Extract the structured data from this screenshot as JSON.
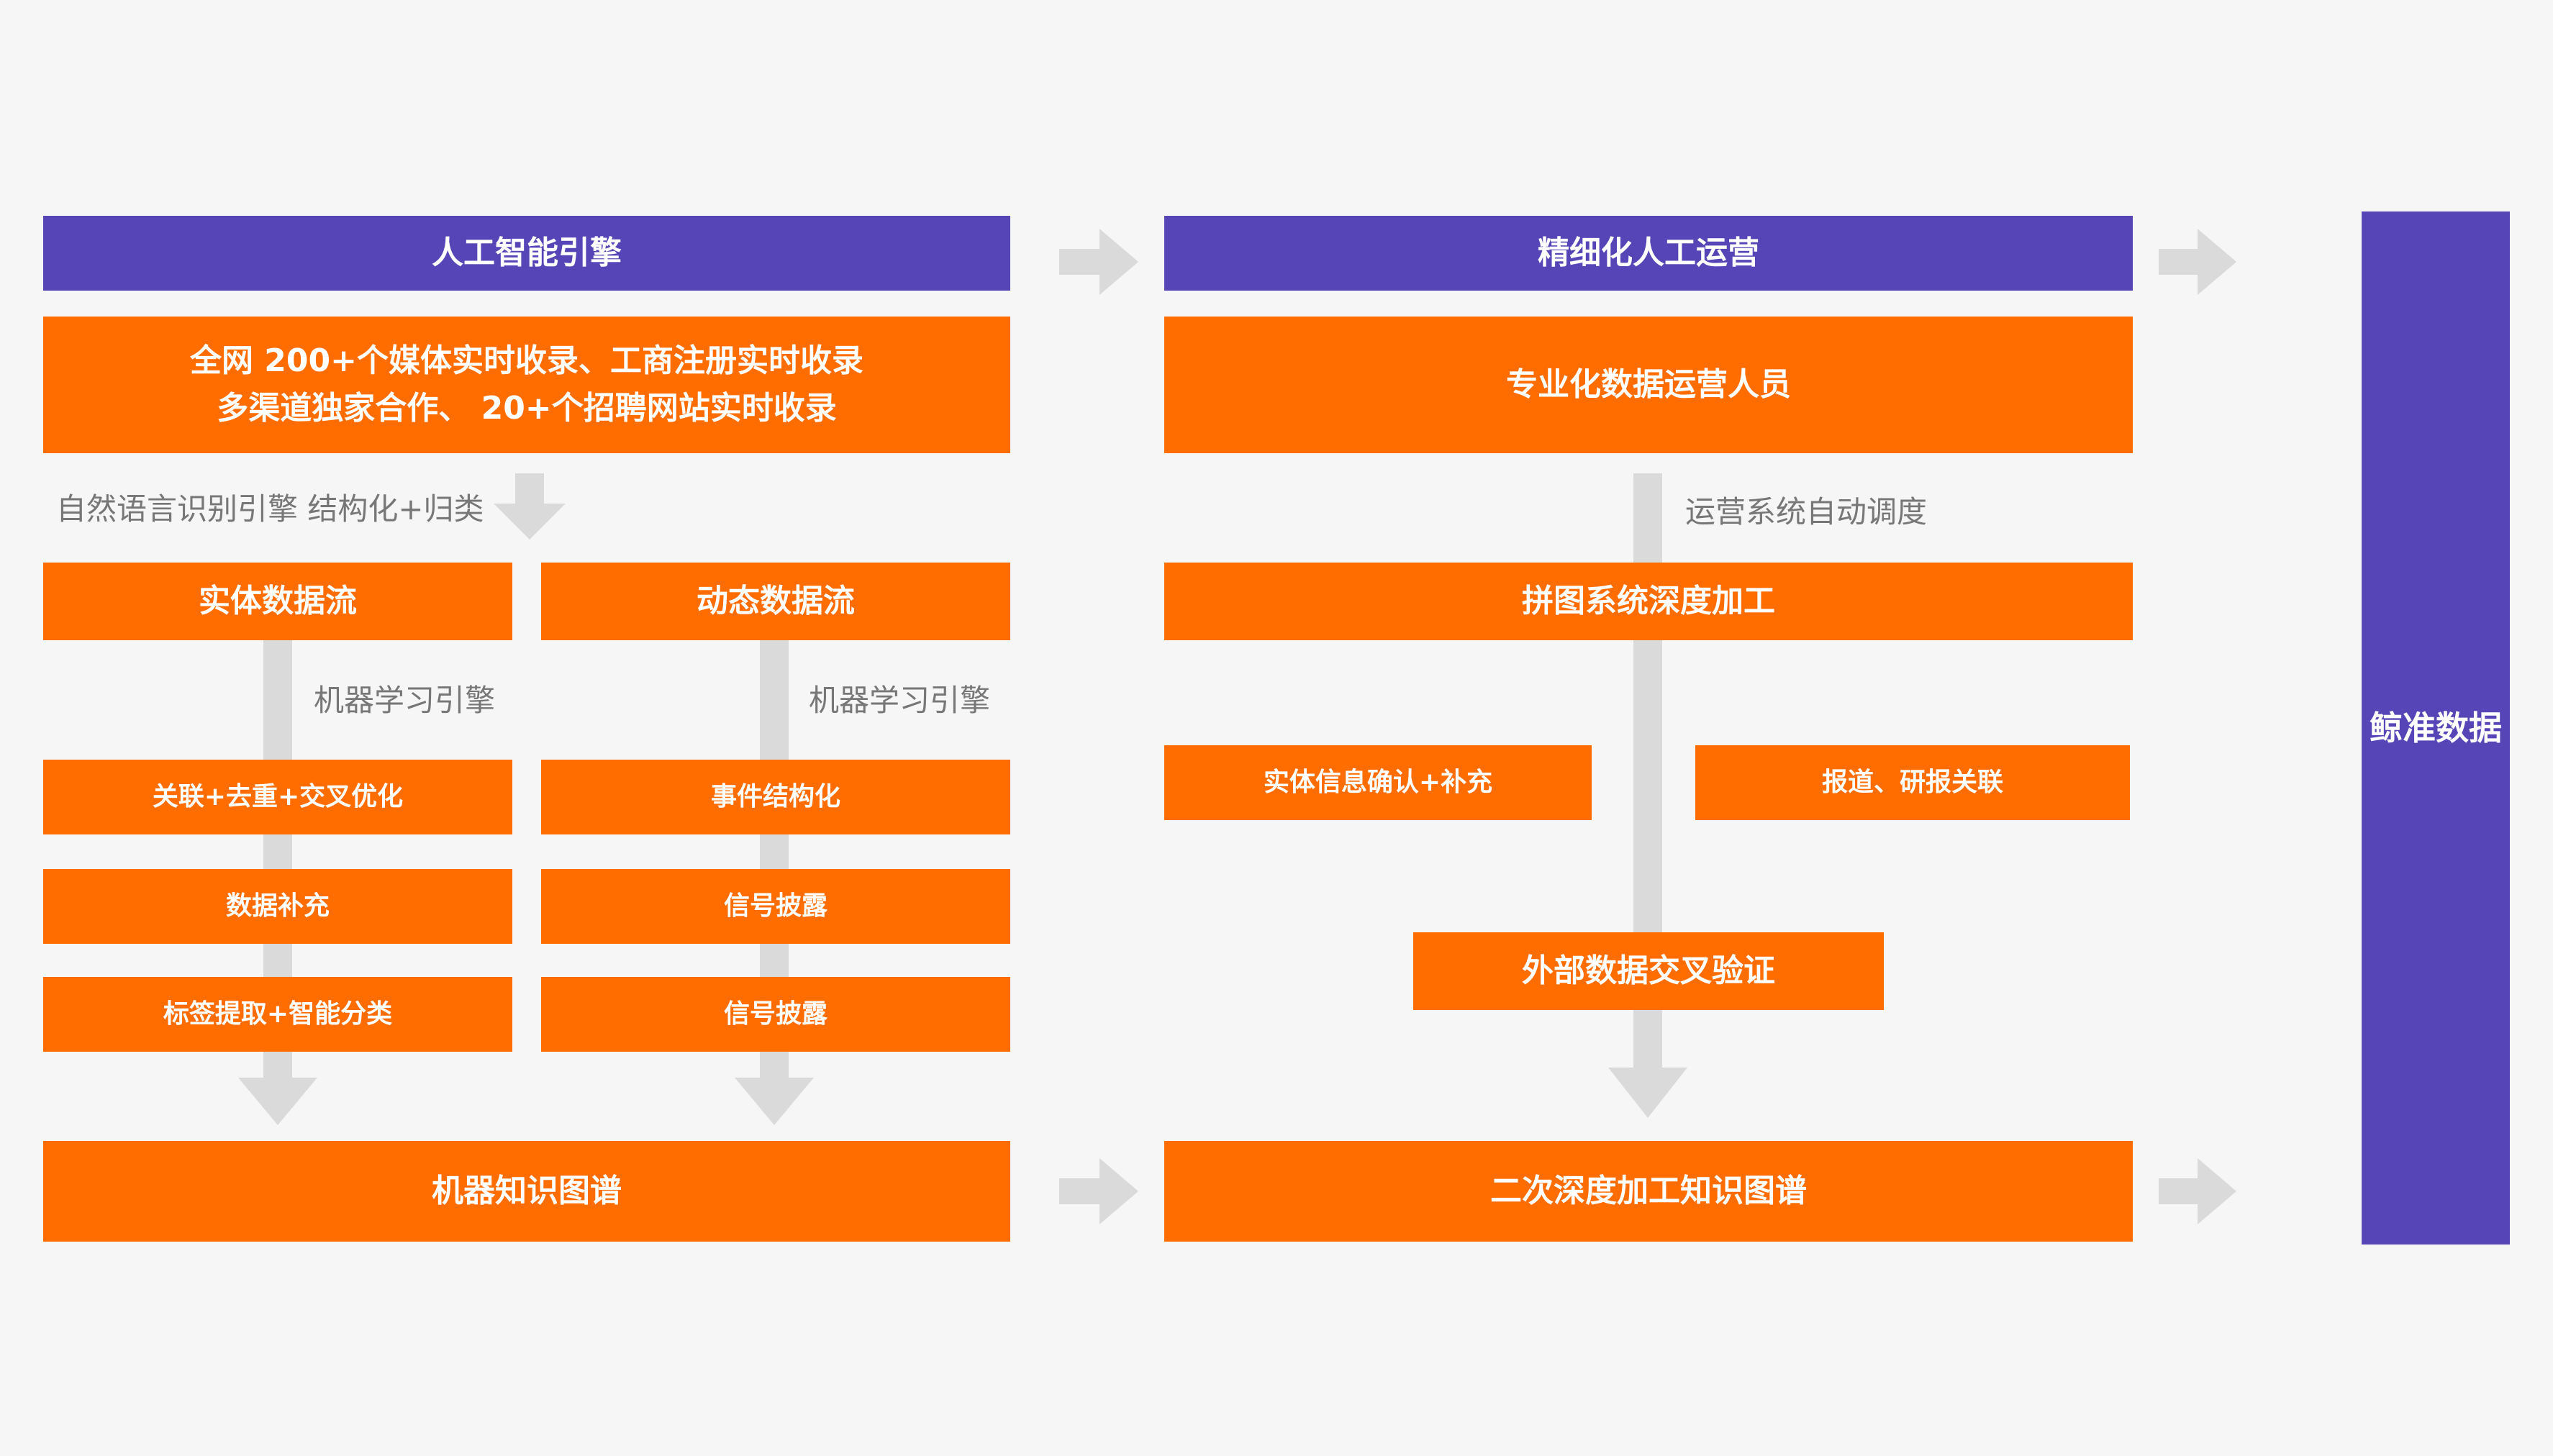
{
  "colors": {
    "purple": "#5545b6",
    "orange": "#ff6c00",
    "connector": "#dadada",
    "label": "#777777"
  },
  "ai_engine": {
    "title": "人工智能引擎",
    "sources_line1": "全网 200+个媒体实时收录、工商注册实时收录",
    "sources_line2": "多渠道独家合作、 20+个招聘网站实时收录",
    "nlp_label": "自然语言识别引擎 结构化+归类",
    "entity_stream": {
      "title": "实体数据流",
      "ml_label": "机器学习引擎",
      "steps": [
        "关联+去重+交叉优化",
        "数据补充",
        "标签提取+智能分类"
      ]
    },
    "dynamic_stream": {
      "title": "动态数据流",
      "ml_label": "机器学习引擎",
      "steps": [
        "事件结构化",
        "信号披露",
        "信号披露"
      ]
    },
    "output": "机器知识图谱"
  },
  "manual_ops": {
    "title": "精细化人工运营",
    "staff": "专业化数据运营人员",
    "scheduling_label": "运营系统自动调度",
    "puzzle": "拼图系统深度加工",
    "entity_confirm": "实体信息确认+补充",
    "report_link": "报道、研报关联",
    "cross_verify": "外部数据交叉验证",
    "output": "二次深度加工知识图谱"
  },
  "final": "鲸准数据"
}
